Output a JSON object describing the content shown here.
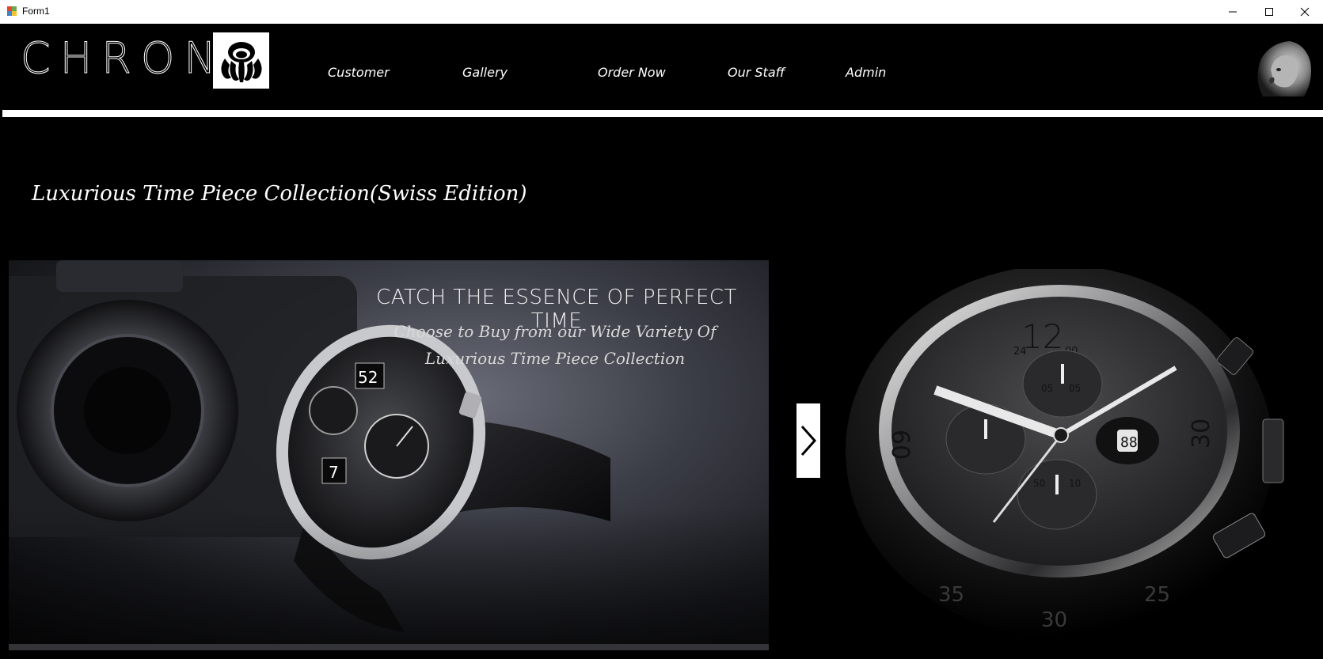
{
  "window": {
    "title": "Form1"
  },
  "header": {
    "logo_text": "CHRONO",
    "nav": [
      {
        "label": "Customer"
      },
      {
        "label": "Gallery"
      },
      {
        "label": "Order Now"
      },
      {
        "label": "Our Staff"
      },
      {
        "label": "Admin"
      }
    ]
  },
  "main": {
    "heading": "Luxurious Time Piece Collection(Swiss Edition)",
    "slide": {
      "headline": "CATCH THE ESSENCE OF PERFECT TIME",
      "subline_1": "Choose to Buy from our Wide Variety Of",
      "subline_2": "Luxurious Time Piece Collection"
    }
  },
  "colors": {
    "background": "#000000",
    "text": "#ffffff",
    "divider": "#ffffff"
  },
  "icons": [
    "app-icon",
    "minimize-icon",
    "maximize-icon",
    "close-icon",
    "octopus-logo-icon",
    "lion-icon",
    "chevron-right-icon"
  ]
}
